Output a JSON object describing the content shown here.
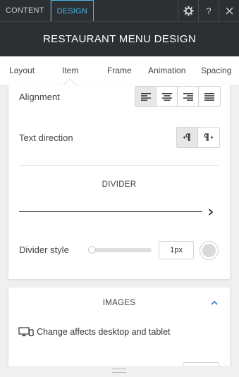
{
  "top_tabs": [
    "CONTENT",
    "DESIGN"
  ],
  "top_icons": [
    "gear-icon",
    "help-icon",
    "close-icon"
  ],
  "help_glyph": "?",
  "title": "RESTAURANT MENU DESIGN",
  "sub_tabs": [
    "Layout",
    "Item",
    "Frame",
    "Animation",
    "Spacing"
  ],
  "active_sub_tab": "Item",
  "alignment": {
    "label": "Alignment",
    "options": [
      "align-left-icon",
      "align-center-icon",
      "align-right-icon",
      "align-justify-icon"
    ],
    "selected": "align-left-icon"
  },
  "text_direction": {
    "label": "Text direction",
    "options": [
      "ltr-icon",
      "rtl-icon"
    ],
    "selected": "ltr-icon"
  },
  "divider": {
    "title": "DIVIDER",
    "style_label": "Divider style",
    "size": "1px",
    "slider_value": 0
  },
  "images": {
    "title": "IMAGES",
    "note": "Change affects desktop and tablet"
  },
  "colors": {
    "dark_bar": "#2c3033",
    "accent": "#4cb3e6",
    "link": "#2a7bd1"
  }
}
